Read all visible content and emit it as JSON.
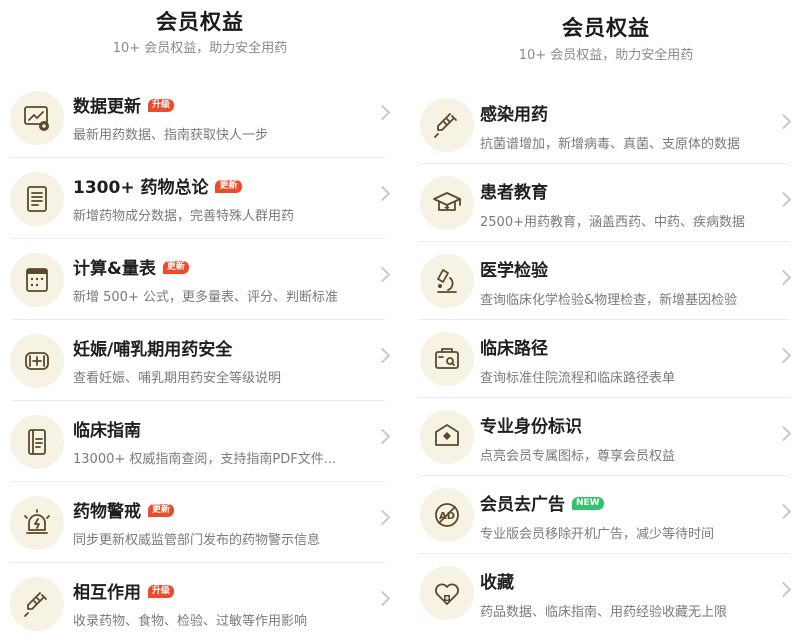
{
  "colors": {
    "icon_bg": "#f6f2e4",
    "icon_fg": "#5b4a2a",
    "badge_red": "#ef4a2a",
    "badge_green": "#35c26e"
  },
  "left": {
    "title": "会员权益",
    "subtitle": "10+ 会员权益，助力安全用药",
    "items": [
      {
        "name": "数据更新",
        "badge": "升级",
        "badge_color": "red",
        "desc": "最新用药数据、指南获取快人一步",
        "icon": "chart-update-icon"
      },
      {
        "name": "1300+ 药物总论",
        "badge": "更新",
        "badge_color": "red",
        "desc": "新增药物成分数据，完善特殊人群用药",
        "icon": "document-icon"
      },
      {
        "name": "计算&量表",
        "badge": "更新",
        "badge_color": "red",
        "desc": "新增 500+ 公式，更多量表、评分、判断标准",
        "icon": "calculator-icon"
      },
      {
        "name": "妊娠/哺乳期用药安全",
        "badge": "",
        "badge_color": "",
        "desc": "查看妊娠、哺乳期用药安全等级说明",
        "icon": "pregnancy-safety-icon"
      },
      {
        "name": "临床指南",
        "badge": "",
        "badge_color": "",
        "desc": "13000+ 权威指南查阅，支持指南PDF文件...",
        "icon": "guide-book-icon"
      },
      {
        "name": "药物警戒",
        "badge": "更新",
        "badge_color": "red",
        "desc": "同步更新权威监管部门发布的药物警示信息",
        "icon": "alarm-icon"
      },
      {
        "name": "相互作用",
        "badge": "升级",
        "badge_color": "red",
        "desc": "收录药物、食物、检验、过敏等作用影响",
        "icon": "syringe-interaction-icon"
      }
    ]
  },
  "right": {
    "title": "会员权益",
    "subtitle": "10+ 会员权益，助力安全用药",
    "items": [
      {
        "name": "感染用药",
        "badge": "",
        "badge_color": "",
        "desc": "抗菌谱增加，新增病毒、真菌、支原体的数据",
        "icon": "syringe-icon"
      },
      {
        "name": "患者教育",
        "badge": "",
        "badge_color": "",
        "desc": "2500+用药教育，涵盖西药、中药、疾病数据",
        "icon": "graduation-cap-icon"
      },
      {
        "name": "医学检验",
        "badge": "",
        "badge_color": "",
        "desc": "查询临床化学检验&物理检查，新增基因检验",
        "icon": "microscope-icon"
      },
      {
        "name": "临床路径",
        "badge": "",
        "badge_color": "",
        "desc": "查询标准住院流程和临床路径表单",
        "icon": "clinical-path-icon"
      },
      {
        "name": "专业身份标识",
        "badge": "",
        "badge_color": "",
        "desc": "点亮会员专属图标，尊享会员权益",
        "icon": "identity-badge-icon"
      },
      {
        "name": "会员去广告",
        "badge": "NEW",
        "badge_color": "green",
        "desc": "专业版会员移除开机广告，减少等待时间",
        "icon": "ad-block-icon"
      },
      {
        "name": "收藏",
        "badge": "",
        "badge_color": "",
        "desc": "药品数据、临床指南、用药经验收藏无上限",
        "icon": "favorite-icon"
      }
    ]
  }
}
